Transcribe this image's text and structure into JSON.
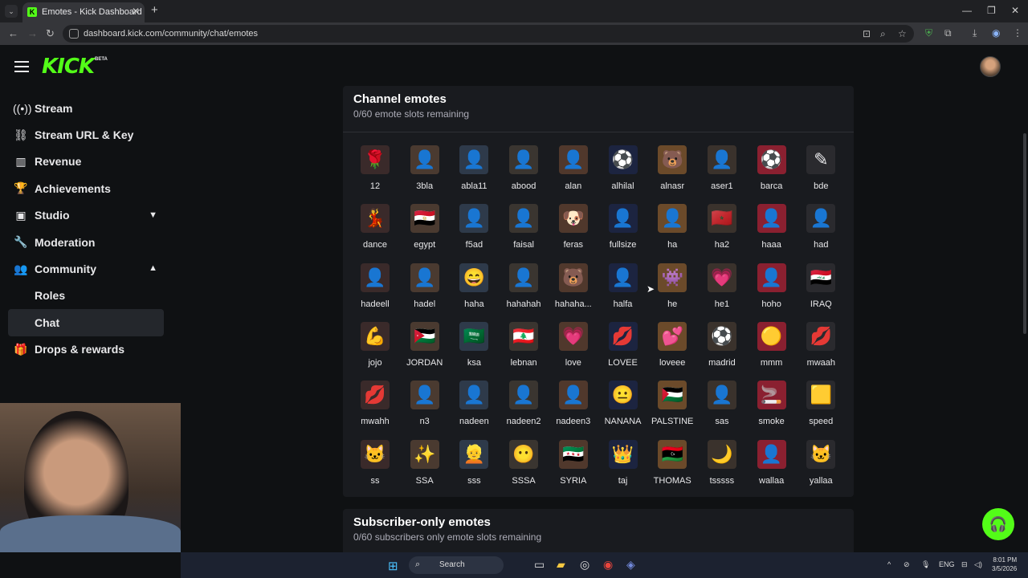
{
  "browser": {
    "tab_title": "Emotes - Kick Dashboard",
    "url": "dashboard.kick.com/community/chat/emotes"
  },
  "brand": {
    "logo": "KICK",
    "badge": "BETA",
    "accent": "#53fc18"
  },
  "sidebar": {
    "items": [
      {
        "label": "Stream",
        "icon": "broadcast-icon"
      },
      {
        "label": "Stream URL & Key",
        "icon": "link-icon"
      },
      {
        "label": "Revenue",
        "icon": "chart-icon"
      },
      {
        "label": "Achievements",
        "icon": "trophy-icon"
      },
      {
        "label": "Studio",
        "icon": "studio-icon"
      },
      {
        "label": "Moderation",
        "icon": "wrench-icon"
      },
      {
        "label": "Community",
        "icon": "users-icon"
      },
      {
        "label": "Roles"
      },
      {
        "label": "Chat"
      },
      {
        "label": "Drops & rewards",
        "icon": "gift-icon"
      }
    ]
  },
  "channel_emotes": {
    "title": "Channel emotes",
    "subtitle": "0/60 emote slots remaining",
    "emotes": [
      "12",
      "3bla",
      "abla11",
      "abood",
      "alan",
      "alhilal",
      "alnasr",
      "aser1",
      "barca",
      "bde",
      "dance",
      "egypt",
      "f5ad",
      "faisal",
      "feras",
      "fullsize",
      "ha",
      "ha2",
      "haaa",
      "had",
      "hadeell",
      "hadel",
      "haha",
      "hahahah",
      "hahaha...",
      "halfa",
      "he",
      "he1",
      "hoho",
      "IRAQ",
      "jojo",
      "JORDAN",
      "ksa",
      "lebnan",
      "love",
      "LOVEE",
      "loveee",
      "madrid",
      "mmm",
      "mwaah",
      "mwahh",
      "n3",
      "nadeen",
      "nadeen2",
      "nadeen3",
      "NANANA",
      "PALSTINE",
      "sas",
      "smoke",
      "speed",
      "ss",
      "SSA",
      "sss",
      "SSSA",
      "SYRIA",
      "taj",
      "THOMAS",
      "tsssss",
      "wallaa",
      "yallaa"
    ]
  },
  "subscriber_emotes": {
    "title": "Subscriber-only emotes",
    "subtitle": "0/60 subscribers only emote slots remaining"
  },
  "taskbar": {
    "search_label": "Search",
    "lang": "ENG",
    "time": "8:01 PM",
    "date": "3/5/2026"
  }
}
